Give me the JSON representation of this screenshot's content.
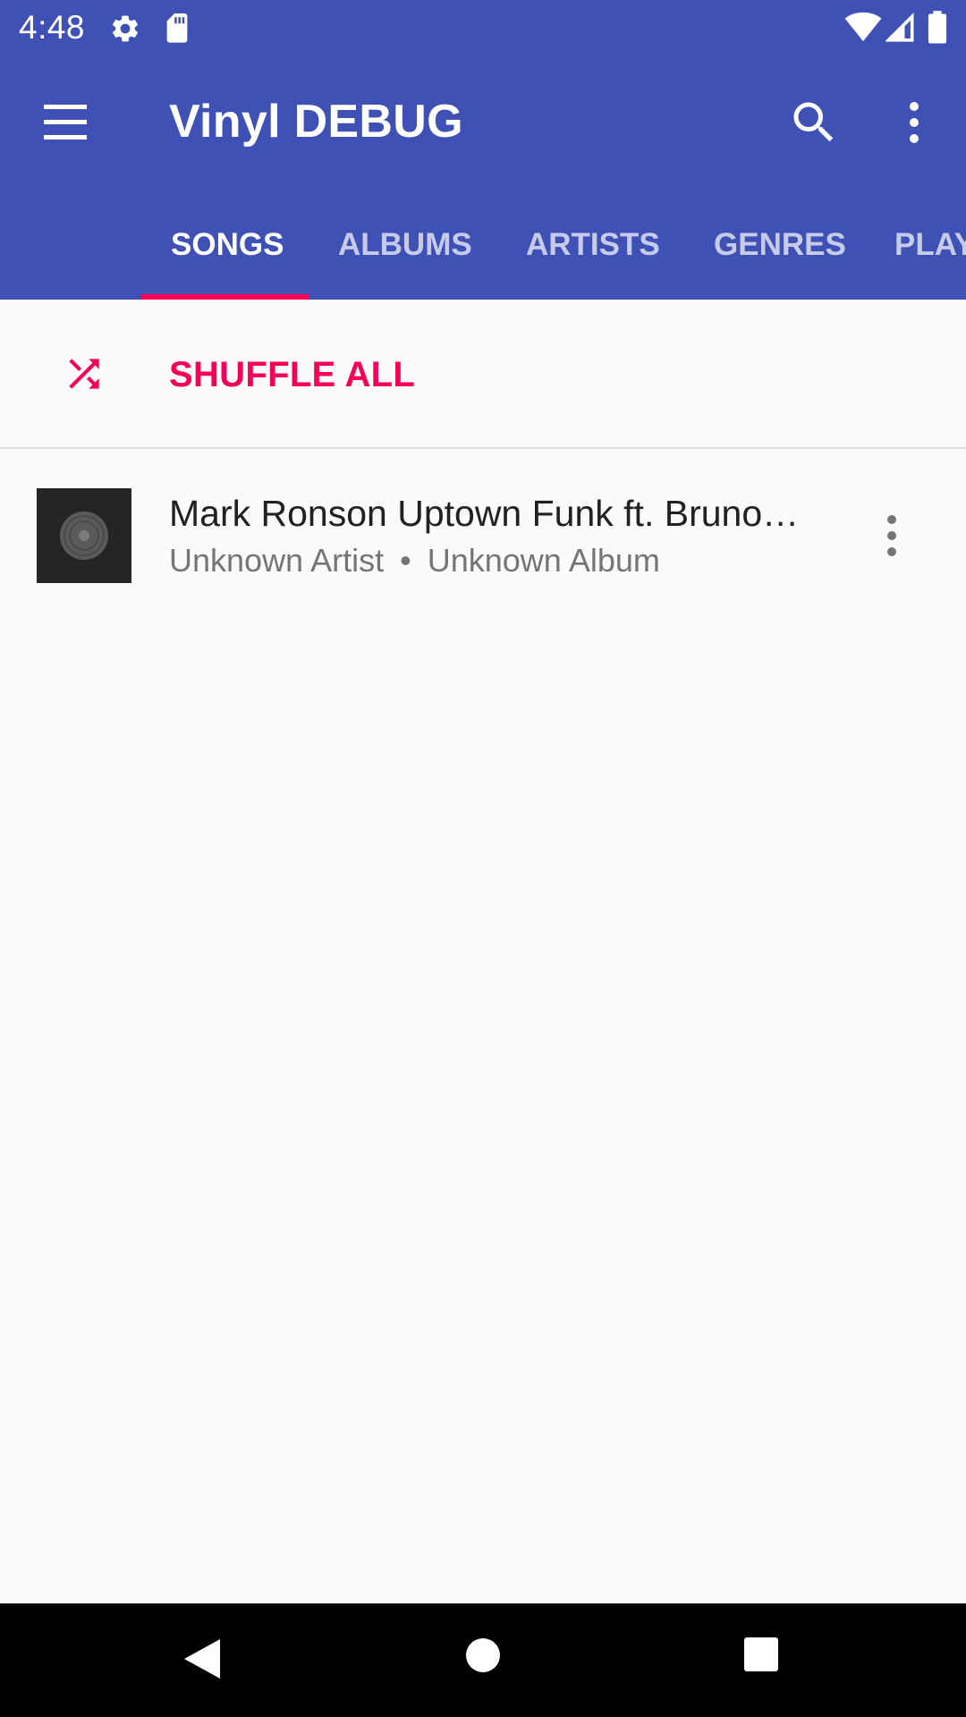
{
  "status_bar": {
    "time": "4:48",
    "icons": [
      "settings-icon",
      "sd-card-icon",
      "wifi-icon",
      "cell-signal-icon",
      "battery-icon"
    ]
  },
  "toolbar": {
    "title": "Vinyl DEBUG",
    "icons": [
      "menu-icon",
      "search-icon",
      "more-vert-icon"
    ]
  },
  "tabs": [
    {
      "label": "SONGS",
      "active": true
    },
    {
      "label": "ALBUMS",
      "active": false
    },
    {
      "label": "ARTISTS",
      "active": false
    },
    {
      "label": "GENRES",
      "active": false
    },
    {
      "label": "PLAYLISTS",
      "active": false
    }
  ],
  "shuffle": {
    "label": "SHUFFLE ALL",
    "icon": "shuffle-icon"
  },
  "songs": [
    {
      "title": "Mark Ronson  Uptown Funk ft. Bruno…",
      "artist": "Unknown Artist",
      "separator": "•",
      "album": "Unknown Album"
    }
  ],
  "nav_bar": {
    "icons": [
      "back-icon",
      "home-icon",
      "recents-icon"
    ]
  },
  "colors": {
    "primary": "#3F51B5",
    "accent": "#F50057",
    "background": "#FAFAFA",
    "text_primary": "#212121",
    "text_secondary": "#757575"
  }
}
